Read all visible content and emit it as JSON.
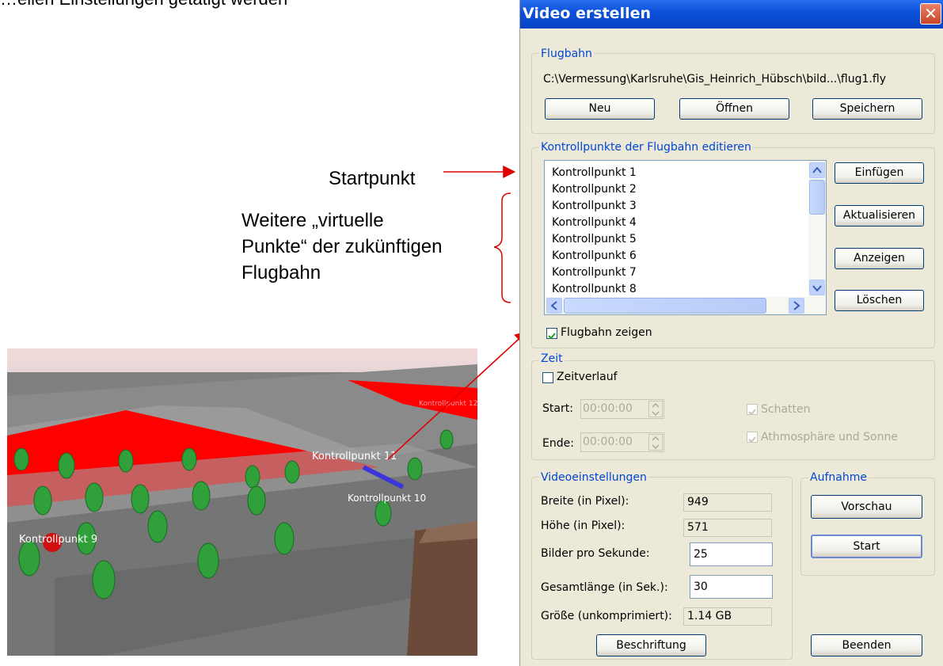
{
  "top_text": "…ellen Einstellungen getätigt werden",
  "annotations": {
    "startpunkt": "Startpunkt",
    "weitere_line1": "Weitere „virtuelle",
    "weitere_line2": "Punkte“ der zukünftigen",
    "weitere_line3": "Flugbahn"
  },
  "dialog": {
    "title": "Video erstellen",
    "close_glyph": "✕",
    "flugbahn": {
      "label": "Flugbahn",
      "path": "C:\\Vermessung\\Karlsruhe\\Gis_Heinrich_Hübsch\\bild...\\flug1.fly",
      "buttons": {
        "neu": "Neu",
        "oeffnen": "Öffnen",
        "speichern": "Speichern"
      }
    },
    "kontroll": {
      "label": "Kontrollpunkte der Flugbahn editieren",
      "items": [
        "Kontrollpunkt 1",
        "Kontrollpunkt 2",
        "Kontrollpunkt 3",
        "Kontrollpunkt 4",
        "Kontrollpunkt 5",
        "Kontrollpunkt 6",
        "Kontrollpunkt 7",
        "Kontrollpunkt 8"
      ],
      "buttons": {
        "einfuegen": "Einfügen",
        "aktualisieren": "Aktualisieren",
        "anzeigen": "Anzeigen",
        "loeschen": "Löschen"
      },
      "show_path_label": "Flugbahn zeigen",
      "show_path_checked": true
    },
    "zeit": {
      "label": "Zeit",
      "zeitverlauf_label": "Zeitverlauf",
      "zeitverlauf_checked": false,
      "start_label": "Start:",
      "start_value": "00:00:00",
      "ende_label": "Ende:",
      "ende_value": "00:00:00",
      "schatten_label": "Schatten",
      "atmo_label": "Athmosphäre und Sonne"
    },
    "video": {
      "label": "Videoeinstellungen",
      "breite_label": "Breite (in Pixel):",
      "breite_value": "949",
      "hoehe_label": "Höhe (in Pixel):",
      "hoehe_value": "571",
      "bps_label": "Bilder pro Sekunde:",
      "bps_value": "25",
      "laenge_label": "Gesamtlänge (in Sek.):",
      "laenge_value": "30",
      "groesse_label": "Größe (unkomprimiert):",
      "groesse_value": "1.14 GB",
      "beschriftung": "Beschriftung"
    },
    "aufnahme": {
      "label": "Aufnahme",
      "vorschau": "Vorschau",
      "start": "Start"
    },
    "beenden": "Beenden"
  },
  "scene": {
    "label_9": "Kontrollpunkt 9",
    "label_10": "Kontrollpunkt 10",
    "label_11": "Kontrollpunkt 11",
    "label_top": "Kontrollpunkt 12"
  },
  "colors": {
    "title_blue": "#0a4fd8",
    "group_label": "#0046d5",
    "dialog_bg": "#ece9d8",
    "annotation_arrow": "#e00000"
  }
}
